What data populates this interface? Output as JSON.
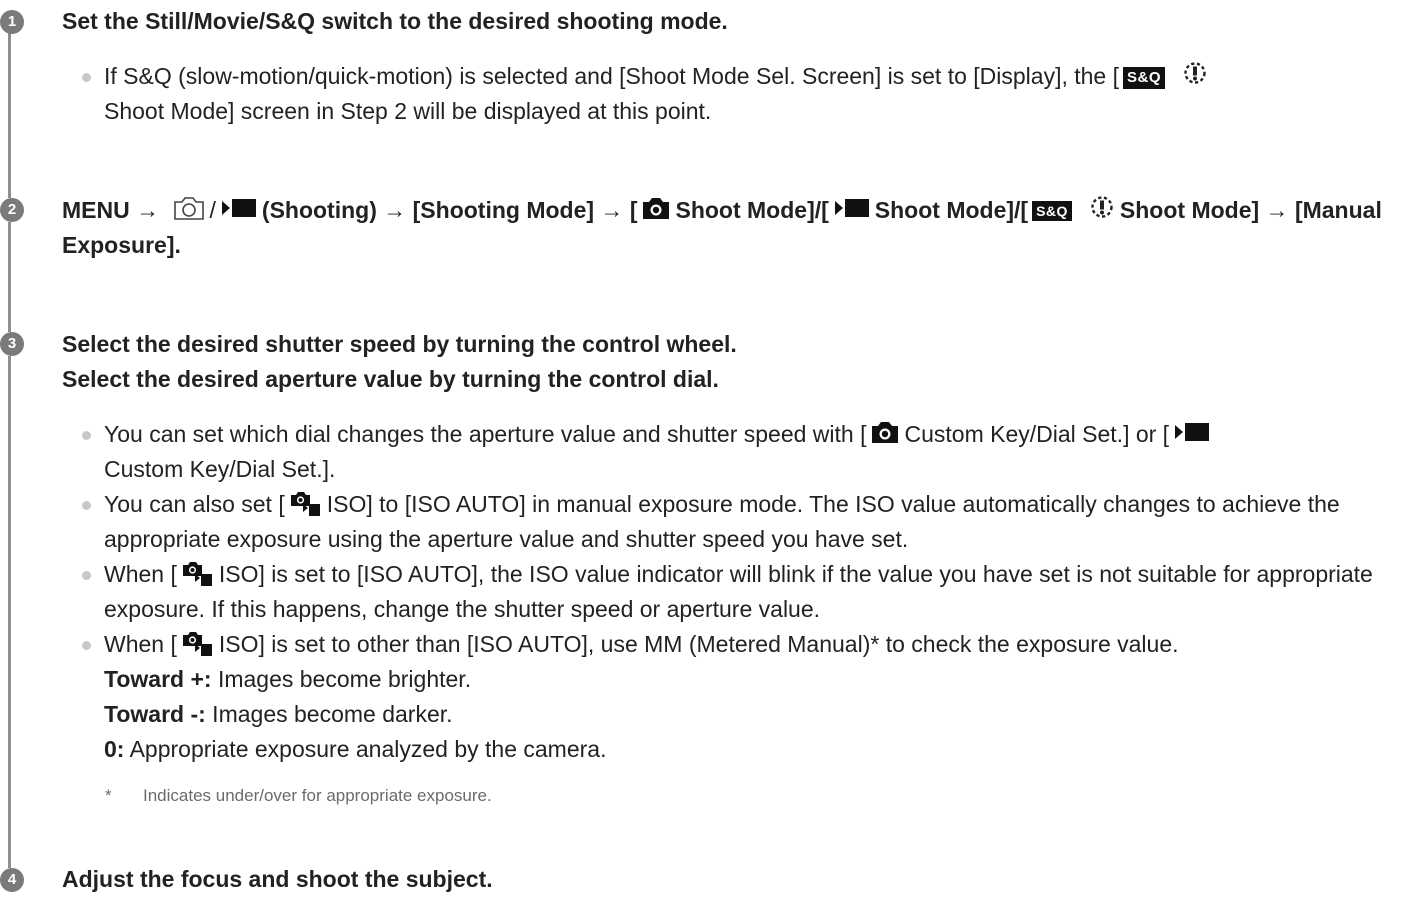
{
  "steps": [
    {
      "number": "1",
      "title": "Set the Still/Movie/S&Q switch to the desired shooting mode.",
      "bullets": [
        {
          "part1": "If S&Q (slow-motion/quick-motion) is selected and [Shoot Mode Sel. Screen] is set to [Display], the [",
          "part2": "Shoot Mode] screen in Step 2 will be displayed at this point."
        }
      ]
    },
    {
      "number": "2",
      "title_parts": {
        "menu": "MENU →",
        "slash": "/",
        "shooting": "(Shooting) → [Shooting Mode] → [",
        "still_mode": "Shoot Mode]/[",
        "movie_mode": "Shoot Mode]/[",
        "sq_mode": "Shoot Mode] → [Manual Exposure]."
      }
    },
    {
      "number": "3",
      "title_line1": "Select the desired shutter speed by turning the control wheel.",
      "title_line2": "Select the desired aperture value by turning the control dial.",
      "bullets": [
        {
          "part1": "You can set which dial changes the aperture value and shutter speed with [",
          "part2": "Custom Key/Dial Set.] or [",
          "part3": "Custom Key/Dial Set.]."
        },
        {
          "part1": "You can also set [",
          "part2": "ISO] to [ISO AUTO] in manual exposure mode. The ISO value automatically changes to achieve the appropriate exposure using the aperture value and shutter speed you have set."
        },
        {
          "part1": "When [",
          "part2": "ISO] is set to [ISO AUTO], the ISO value indicator will blink if the value you have set is not suitable for appropriate exposure. If this happens, change the shutter speed or aperture value."
        },
        {
          "part1": "When [",
          "part2": "ISO] is set to other than [ISO AUTO], use MM (Metered Manual)* to check the exposure value."
        }
      ],
      "exposure_guide": [
        {
          "term": "Toward +:",
          "desc": " Images become brighter."
        },
        {
          "term": "Toward -:",
          "desc": " Images become darker."
        },
        {
          "term": "0:",
          "desc": " Appropriate exposure analyzed by the camera."
        }
      ],
      "footnote": {
        "marker": "*",
        "text": "Indicates under/over for appropriate exposure."
      }
    },
    {
      "number": "4",
      "title": "Adjust the focus and shoot the subject."
    }
  ],
  "icons": {
    "sq_label": "S&Q",
    "sq_label_alt": "S&Q",
    "camera_outline": "camera-outline-icon",
    "camera_solid": "camera-icon",
    "movie": "movie-camera-icon",
    "dial": "dial-icon",
    "iso": "iso-icon"
  },
  "colors": {
    "text": "#222222",
    "step_circle": "#7a7a7a",
    "rail": "#8f8f8f",
    "bullet": "#c8c8c8",
    "footnote": "#6b6b6b"
  }
}
